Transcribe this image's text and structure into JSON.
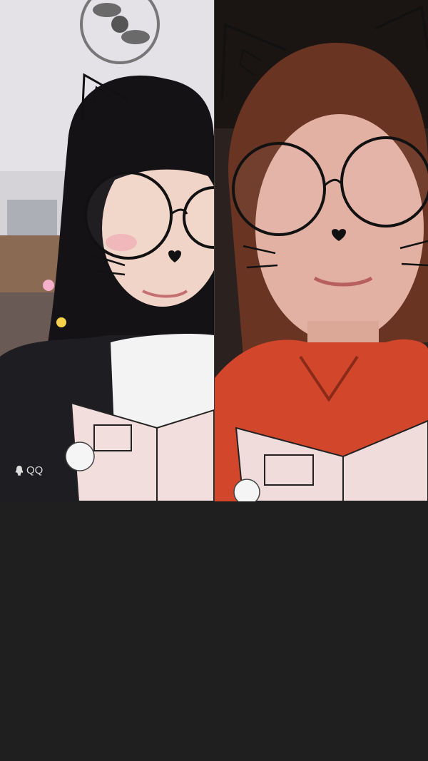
{
  "watermark": {
    "icon": "qq-penguin-icon",
    "label": "QQ"
  },
  "colors": {
    "background": "#1f1f1f",
    "left_jacket": "#1e1e22",
    "right_jacket": "#d2462c"
  }
}
